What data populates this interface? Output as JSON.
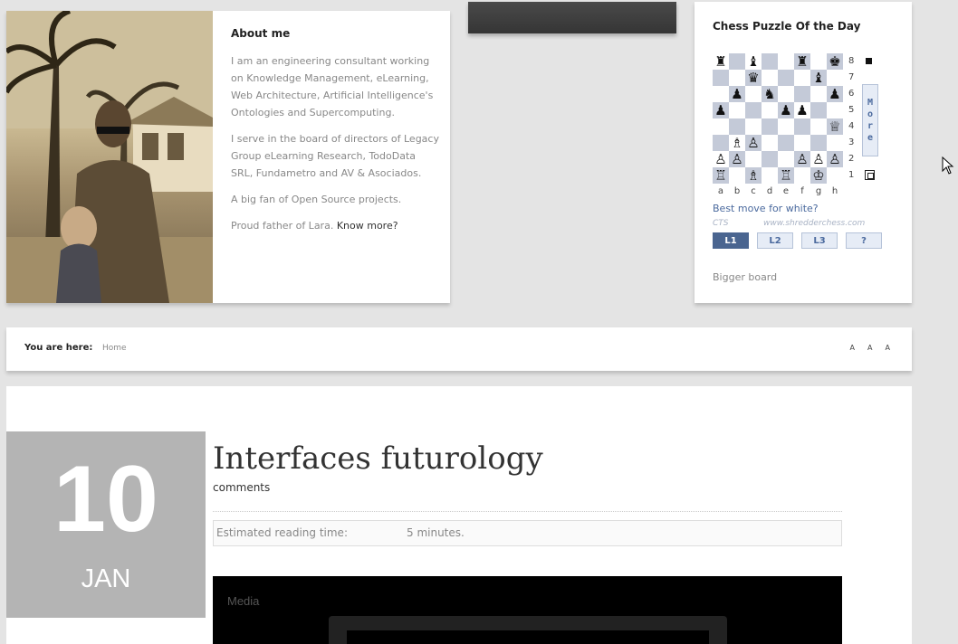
{
  "about": {
    "title": "About me",
    "p1": "I am an engineering consultant working on Knowledge Management, eLearning, Web Architecture, Artificial Intelligence's Ontologies and Supercomputing.",
    "p2": "I serve in the board of directors of Legacy Group eLearning Research, TodoData SRL, Fundametro and AV & Asociados.",
    "p3": "A big fan of Open Source projects.",
    "p4": "Proud father of Lara.",
    "know_more": "Know more?"
  },
  "chess": {
    "title": "Chess Puzzle Of the Day",
    "board": [
      [
        "♜",
        "",
        "♝",
        "",
        "",
        "♜",
        "",
        "♚"
      ],
      [
        "",
        "",
        "♛",
        "",
        "",
        "",
        "♝",
        ""
      ],
      [
        "",
        "♟",
        "",
        "♞",
        "",
        "",
        "",
        "♟"
      ],
      [
        "♟",
        "",
        "",
        "",
        "♟",
        "♟",
        "",
        ""
      ],
      [
        "",
        "",
        "",
        "",
        "",
        "",
        "",
        "♕"
      ],
      [
        "",
        "♗",
        "♙",
        "",
        "",
        "",
        "",
        ""
      ],
      [
        "♙",
        "♙",
        "",
        "",
        "",
        "♙",
        "♙",
        "♙"
      ],
      [
        "♖",
        "",
        "♗",
        "",
        "♖",
        "",
        "♔",
        ""
      ]
    ],
    "ranks": [
      "8",
      "7",
      "6",
      "5",
      "4",
      "3",
      "2",
      "1"
    ],
    "files": [
      "a",
      "b",
      "c",
      "d",
      "e",
      "f",
      "g",
      "h"
    ],
    "more_letters": [
      "M",
      "o",
      "r",
      "e"
    ],
    "best_move": "Best move for white?",
    "cts": "CTS",
    "site": "www.shredderchess.com",
    "levels": [
      "L1",
      "L2",
      "L3",
      "?"
    ],
    "bigger_board": "Bigger board"
  },
  "breadcrumb": {
    "label": "You are here:",
    "home": "Home",
    "font_sizes": [
      "A",
      "A",
      "A"
    ]
  },
  "post": {
    "day": "10",
    "month": "JAN",
    "title": "Interfaces futurology",
    "comments": "comments",
    "reading_label": "Estimated reading time:",
    "reading_value": "5 minutes.",
    "media_label": "Media"
  },
  "colors": {
    "accent_blue": "#4b6a9e",
    "date_box": "#b4b4b4",
    "page_bg": "#e4e4e4"
  }
}
